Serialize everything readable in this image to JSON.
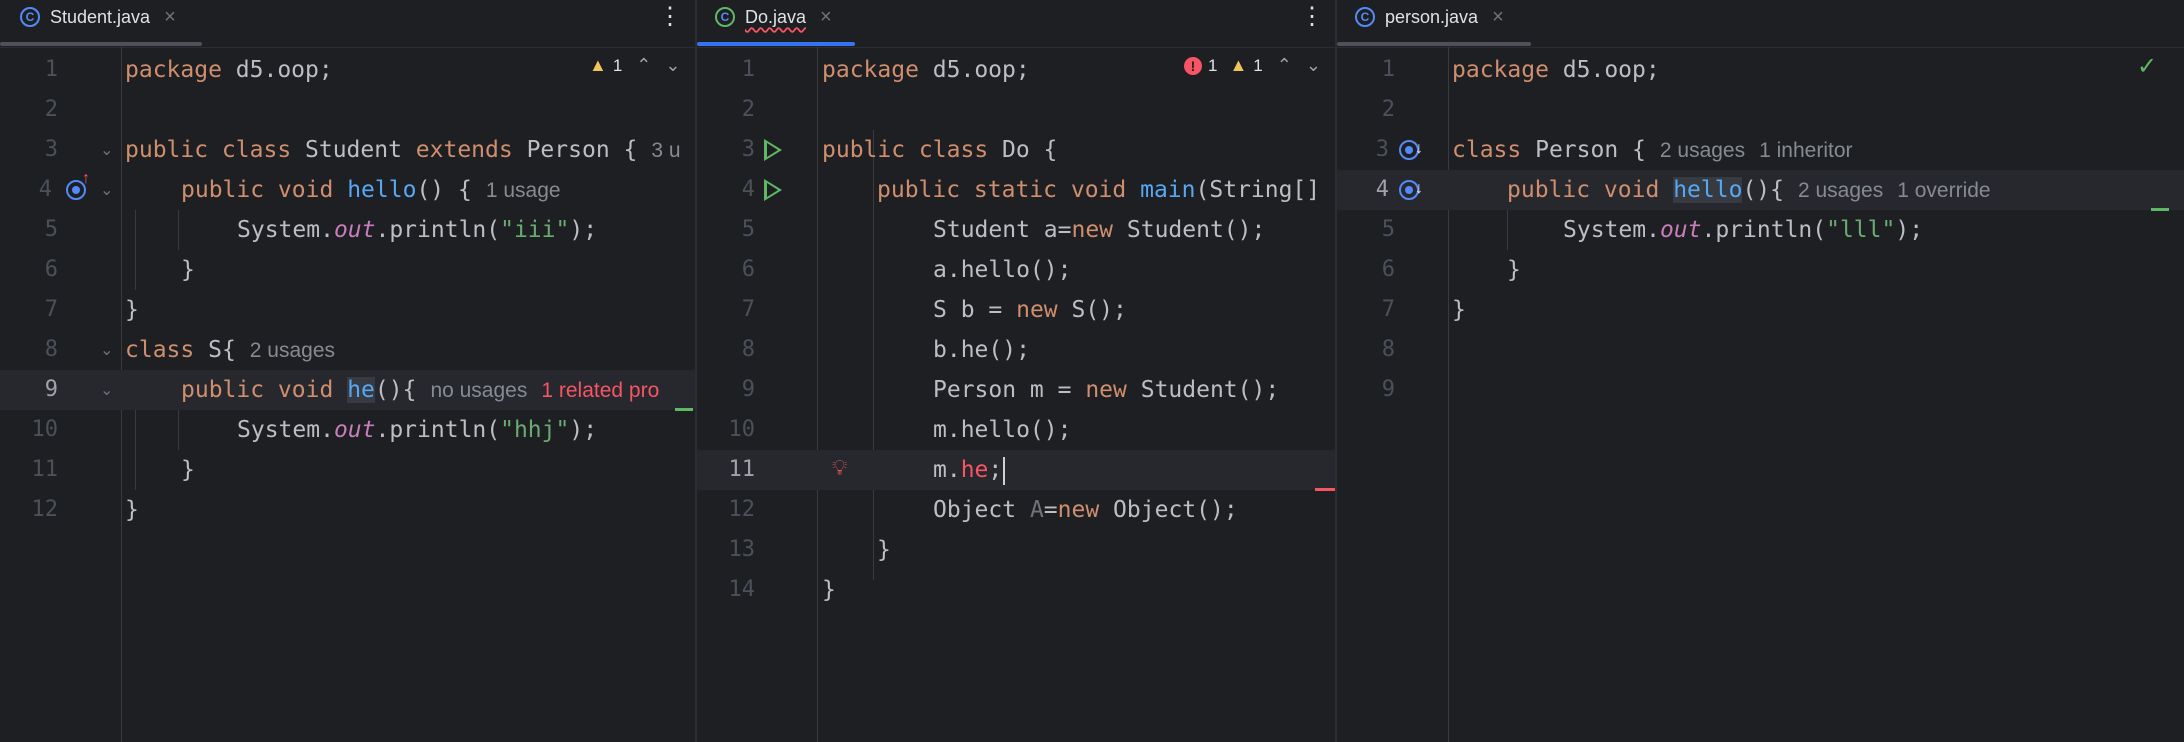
{
  "colors": {
    "background": "#1e1f22",
    "keyword": "#cf8e6d",
    "method": "#56a8f5",
    "string": "#6aab73",
    "static_field": "#c77dbb",
    "error": "#f75464",
    "warning": "#f2c55c",
    "ok": "#5fb865",
    "accent": "#548af7"
  },
  "editors": [
    {
      "tab": {
        "label": "Student.java",
        "icon": "class-icon"
      },
      "inspections": {
        "warnings": "1"
      },
      "lines": [
        {
          "n": "1",
          "t": {
            "a": "package",
            "b": " d5.oop;"
          }
        },
        {
          "n": "2"
        },
        {
          "n": "3",
          "t": {
            "a": "public class",
            "b": " Student ",
            "c": "extends",
            "d": " Person {",
            "hint": "3 u"
          }
        },
        {
          "n": "4",
          "t": {
            "a": "public void",
            "b": "hello",
            "c": "() {",
            "hint": "1 usage"
          }
        },
        {
          "n": "5",
          "t": {
            "a": "System.",
            "b": "out",
            "c": ".println(",
            "d": "\"iii\"",
            "e": ");"
          }
        },
        {
          "n": "6",
          "t": {
            "a": "}"
          }
        },
        {
          "n": "7",
          "t": {
            "a": "}"
          }
        },
        {
          "n": "8",
          "t": {
            "a": "class",
            "b": " S{",
            "hint": "2 usages"
          }
        },
        {
          "n": "9",
          "t": {
            "a": "public void",
            "b": "he",
            "c": "(){",
            "hint": "no usages",
            "hint2": "1 related pro"
          }
        },
        {
          "n": "10",
          "t": {
            "a": "System.",
            "b": "out",
            "c": ".println(",
            "d": "\"hhj\"",
            "e": ");"
          }
        },
        {
          "n": "11",
          "t": {
            "a": "}"
          }
        },
        {
          "n": "12",
          "t": {
            "a": "}"
          }
        }
      ]
    },
    {
      "tab": {
        "label": "Do.java",
        "icon": "runnable-class-icon"
      },
      "inspections": {
        "errors": "1",
        "warnings": "1"
      },
      "lines": [
        {
          "n": "1",
          "t": {
            "a": "package",
            "b": " d5.oop;"
          }
        },
        {
          "n": "2"
        },
        {
          "n": "3",
          "t": {
            "a": "public class",
            "b": " Do {"
          }
        },
        {
          "n": "4",
          "t": {
            "a": "public static void",
            "b": "main",
            "c": "(String[]"
          }
        },
        {
          "n": "5",
          "t": {
            "a": "Student a=",
            "b": "new",
            "c": " Student();"
          }
        },
        {
          "n": "6",
          "t": {
            "a": "a.hello();"
          }
        },
        {
          "n": "7",
          "t": {
            "a": "S b = ",
            "b": "new",
            "c": " S();"
          }
        },
        {
          "n": "8",
          "t": {
            "a": "b.he();"
          }
        },
        {
          "n": "9",
          "t": {
            "a": "Person m = ",
            "b": "new",
            "c": " Student();"
          }
        },
        {
          "n": "10",
          "t": {
            "a": "m.hello();"
          }
        },
        {
          "n": "11",
          "t": {
            "a": "m.",
            "b": "he",
            "c": ";"
          }
        },
        {
          "n": "12",
          "t": {
            "a": "Object ",
            "b": "A",
            "c": "=",
            "d": "new",
            "e": " Object();"
          }
        },
        {
          "n": "13",
          "t": {
            "a": "}"
          }
        },
        {
          "n": "14",
          "t": {
            "a": "}"
          }
        }
      ]
    },
    {
      "tab": {
        "label": "person.java",
        "icon": "class-icon"
      },
      "inspections": {
        "status": "ok"
      },
      "lines": [
        {
          "n": "1",
          "t": {
            "a": "package",
            "b": " d5.oop;"
          }
        },
        {
          "n": "2"
        },
        {
          "n": "3",
          "t": {
            "a": "class",
            "b": " Person {",
            "hint": "2 usages",
            "hint2": "1 inheritor"
          }
        },
        {
          "n": "4",
          "t": {
            "a": "public void",
            "b": "hello",
            "c": "(){",
            "hint": "2 usages",
            "hint2": "1 override"
          }
        },
        {
          "n": "5",
          "t": {
            "a": "System.",
            "b": "out",
            "c": ".println(",
            "d": "\"lll\"",
            "e": ");"
          }
        },
        {
          "n": "6",
          "t": {
            "a": "}"
          }
        },
        {
          "n": "7",
          "t": {
            "a": "}"
          }
        },
        {
          "n": "8"
        },
        {
          "n": "9"
        }
      ]
    }
  ]
}
